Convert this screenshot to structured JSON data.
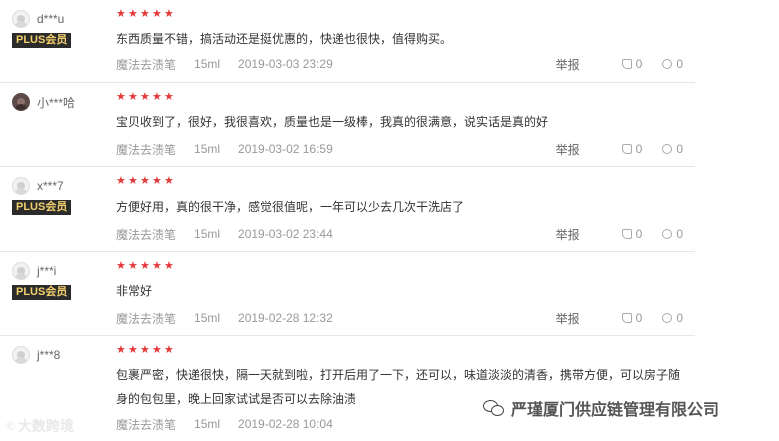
{
  "reviews": [
    {
      "username": "d***u",
      "badge": "PLUS会员",
      "rating": 5,
      "content": "东西质量不错，搞活动还是挺优惠的，快递也很快，值得购买。",
      "product": "魔法去渍笔",
      "spec": "15ml",
      "date": "2019-03-03 23:29",
      "report": "举报",
      "likes": "0",
      "replies": "0"
    },
    {
      "username": "小***哈",
      "badge": "",
      "rating": 5,
      "content": "宝贝收到了，很好，我很喜欢，质量也是一级棒，我真的很满意，说实话是真的好",
      "product": "魔法去渍笔",
      "spec": "15ml",
      "date": "2019-03-02 16:59",
      "report": "举报",
      "likes": "0",
      "replies": "0"
    },
    {
      "username": "x***7",
      "badge": "PLUS会员",
      "rating": 5,
      "content": "方便好用，真的很干净，感觉很值呢，一年可以少去几次干洗店了",
      "product": "魔法去渍笔",
      "spec": "15ml",
      "date": "2019-03-02 23:44",
      "report": "举报",
      "likes": "0",
      "replies": "0"
    },
    {
      "username": "j***i",
      "badge": "PLUS会员",
      "rating": 5,
      "content": "非常好",
      "product": "魔法去渍笔",
      "spec": "15ml",
      "date": "2019-02-28 12:32",
      "report": "举报",
      "likes": "0",
      "replies": "0"
    },
    {
      "username": "j***8",
      "badge": "",
      "rating": 5,
      "content": "包裹严密，快递很快，隔一天就到啦，打开后用了一下，还可以，味道淡淡的清香，携带方便，可以房子随身的包包里，晚上回家试试是否可以去除油渍",
      "product": "魔法去渍笔",
      "spec": "15ml",
      "date": "2019-02-28 10:04",
      "report": "举报",
      "likes": "0",
      "replies": "0"
    }
  ],
  "watermarks": {
    "left": "大数跨境",
    "right": "严瑾厦门供应链管理有限公司"
  },
  "colors": {
    "star": "#e4393c",
    "plus_badge_bg": "#2b2b2b",
    "plus_badge_text": "#f3cf6c"
  }
}
